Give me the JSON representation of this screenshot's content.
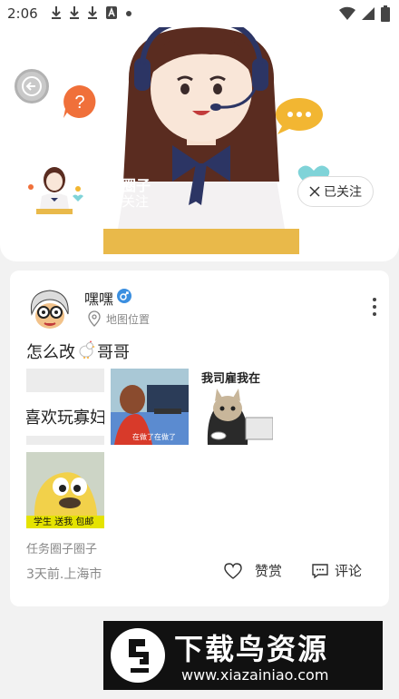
{
  "status_bar": {
    "time": "2:06",
    "left_icons": [
      "download-icon",
      "download-icon",
      "download-icon",
      "a-icon",
      "dot-icon"
    ],
    "right_icons": [
      "wifi-icon",
      "signal-icon",
      "battery-icon"
    ]
  },
  "header": {
    "circle_title": "圈子",
    "circle_subtitle": "关注",
    "follow_label": "已关注",
    "brand_color": "#e9b94a"
  },
  "post": {
    "user_name": "嘿嘿",
    "location": "地图位置",
    "text_before": "怎么改",
    "text_after": "哥哥",
    "images": {
      "text_tile": "喜欢玩寡妇",
      "office_caption": "在做了在做了",
      "cat_caption": "我司雇我在",
      "bird_caption": "学生 送我 包邮"
    },
    "circle_tag": "任务圈子圈子",
    "meta": "3天前.上海市",
    "like_label": "赞赏",
    "comment_label": "评论"
  },
  "watermark": {
    "title": "下载鸟资源",
    "url": "www.xiazainiao.com"
  }
}
